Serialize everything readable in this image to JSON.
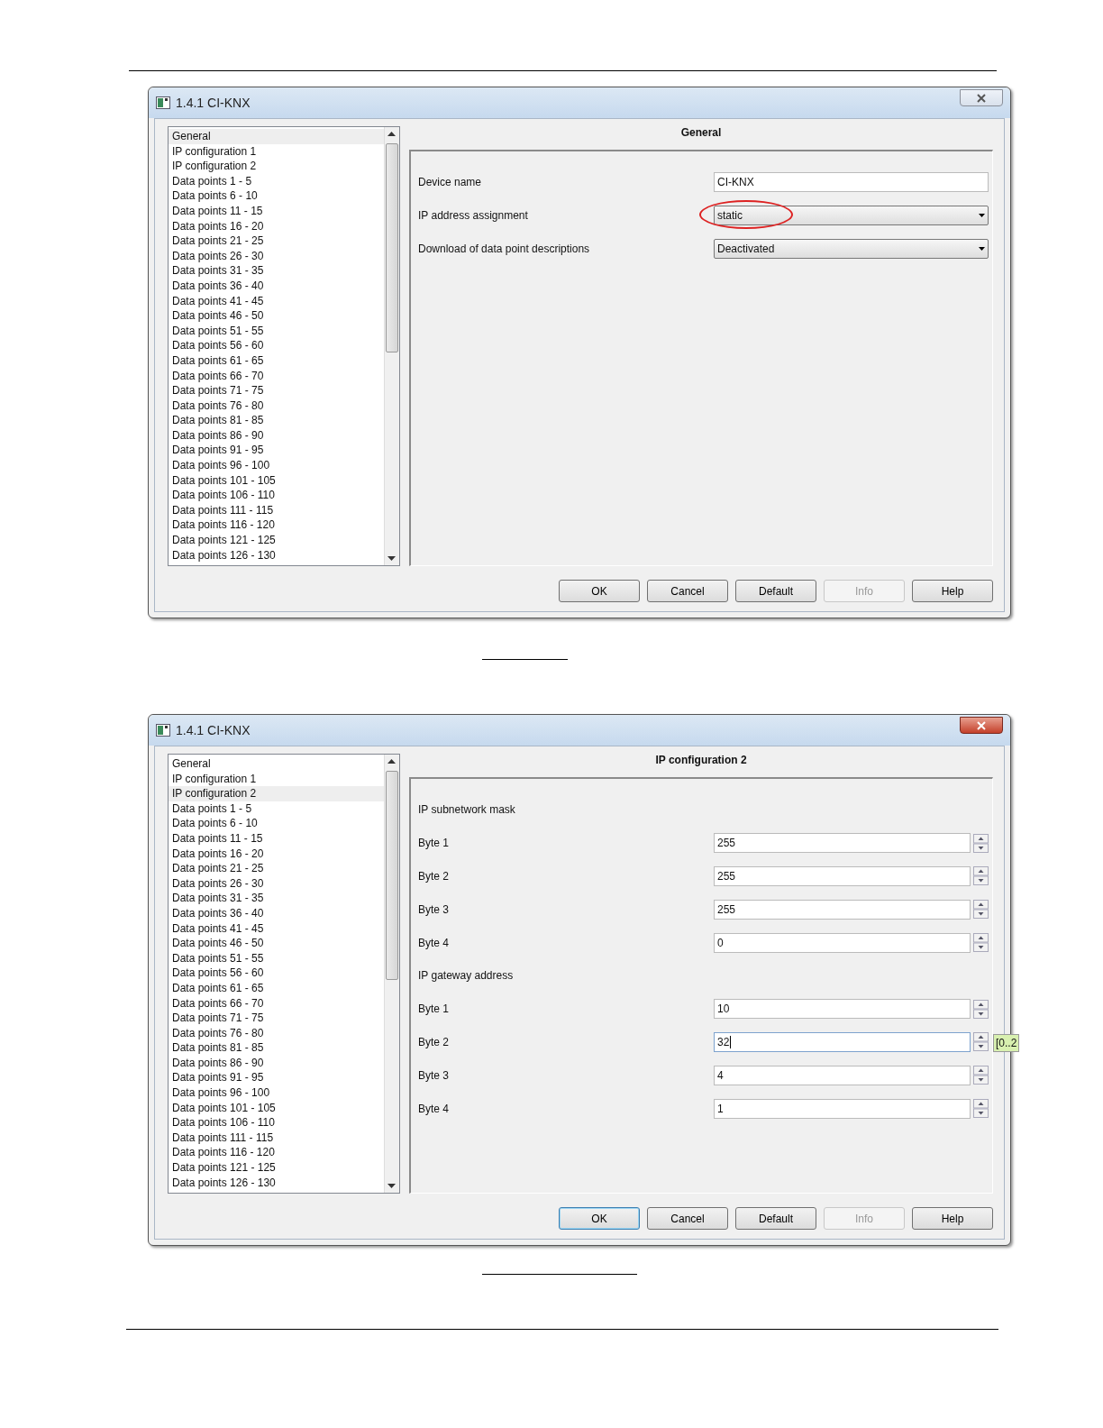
{
  "dialogs": [
    {
      "title": "1.4.1 CI-KNX",
      "active": false,
      "sidebar": {
        "items": [
          {
            "label": "General",
            "selected": true
          },
          {
            "label": "IP configuration 1",
            "selected": false
          },
          {
            "label": "IP configuration 2",
            "selected": false
          },
          {
            "label": "Data points 1 - 5",
            "selected": false
          },
          {
            "label": "Data points 6 - 10",
            "selected": false
          },
          {
            "label": "Data points 11 - 15",
            "selected": false
          },
          {
            "label": "Data points 16 - 20",
            "selected": false
          },
          {
            "label": "Data points 21 - 25",
            "selected": false
          },
          {
            "label": "Data points 26 - 30",
            "selected": false
          },
          {
            "label": "Data points 31 - 35",
            "selected": false
          },
          {
            "label": "Data points 36 - 40",
            "selected": false
          },
          {
            "label": "Data points 41 - 45",
            "selected": false
          },
          {
            "label": "Data points 46 - 50",
            "selected": false
          },
          {
            "label": "Data points 51 - 55",
            "selected": false
          },
          {
            "label": "Data points 56 - 60",
            "selected": false
          },
          {
            "label": "Data points 61 - 65",
            "selected": false
          },
          {
            "label": "Data points 66 - 70",
            "selected": false
          },
          {
            "label": "Data points 71 - 75",
            "selected": false
          },
          {
            "label": "Data points 76 - 80",
            "selected": false
          },
          {
            "label": "Data points 81 - 85",
            "selected": false
          },
          {
            "label": "Data points 86 - 90",
            "selected": false
          },
          {
            "label": "Data points 91 - 95",
            "selected": false
          },
          {
            "label": "Data points 96 - 100",
            "selected": false
          },
          {
            "label": "Data points 101 - 105",
            "selected": false
          },
          {
            "label": "Data points 106 - 110",
            "selected": false
          },
          {
            "label": "Data points 111 - 115",
            "selected": false
          },
          {
            "label": "Data points 116 - 120",
            "selected": false
          },
          {
            "label": "Data points 121 - 125",
            "selected": false
          },
          {
            "label": "Data points 126 - 130",
            "selected": false
          }
        ]
      },
      "panel": {
        "title": "General",
        "rows": [
          {
            "kind": "text",
            "label": "Device name",
            "value": "CI-KNX"
          },
          {
            "kind": "dropdown",
            "label": "IP address assignment",
            "value": "static",
            "circled": true
          },
          {
            "kind": "dropdown",
            "label": "Download of data point descriptions",
            "value": "Deactivated",
            "circled": false
          }
        ]
      },
      "buttons": [
        {
          "label": "OK",
          "disabled": false,
          "default": false
        },
        {
          "label": "Cancel",
          "disabled": false,
          "default": false
        },
        {
          "label": "Default",
          "disabled": false,
          "default": false
        },
        {
          "label": "Info",
          "disabled": true,
          "default": false
        },
        {
          "label": "Help",
          "disabled": false,
          "default": false
        }
      ]
    },
    {
      "title": "1.4.1 CI-KNX",
      "active": true,
      "sidebar": {
        "items": [
          {
            "label": "General",
            "selected": false
          },
          {
            "label": "IP configuration 1",
            "selected": false
          },
          {
            "label": "IP configuration 2",
            "selected": true
          },
          {
            "label": "Data points 1 - 5",
            "selected": false
          },
          {
            "label": "Data points 6 - 10",
            "selected": false
          },
          {
            "label": "Data points 11 - 15",
            "selected": false
          },
          {
            "label": "Data points 16 - 20",
            "selected": false
          },
          {
            "label": "Data points 21 - 25",
            "selected": false
          },
          {
            "label": "Data points 26 - 30",
            "selected": false
          },
          {
            "label": "Data points 31 - 35",
            "selected": false
          },
          {
            "label": "Data points 36 - 40",
            "selected": false
          },
          {
            "label": "Data points 41 - 45",
            "selected": false
          },
          {
            "label": "Data points 46 - 50",
            "selected": false
          },
          {
            "label": "Data points 51 - 55",
            "selected": false
          },
          {
            "label": "Data points 56 - 60",
            "selected": false
          },
          {
            "label": "Data points 61 - 65",
            "selected": false
          },
          {
            "label": "Data points 66 - 70",
            "selected": false
          },
          {
            "label": "Data points 71 - 75",
            "selected": false
          },
          {
            "label": "Data points 76 - 80",
            "selected": false
          },
          {
            "label": "Data points 81 - 85",
            "selected": false
          },
          {
            "label": "Data points 86 - 90",
            "selected": false
          },
          {
            "label": "Data points 91 - 95",
            "selected": false
          },
          {
            "label": "Data points 96 - 100",
            "selected": false
          },
          {
            "label": "Data points 101 - 105",
            "selected": false
          },
          {
            "label": "Data points 106 - 110",
            "selected": false
          },
          {
            "label": "Data points 111 - 115",
            "selected": false
          },
          {
            "label": "Data points 116 - 120",
            "selected": false
          },
          {
            "label": "Data points 121 - 125",
            "selected": false
          },
          {
            "label": "Data points 126 - 130",
            "selected": false
          }
        ]
      },
      "panel": {
        "title": "IP configuration 2",
        "rows": [
          {
            "kind": "heading",
            "label": "IP subnetwork mask"
          },
          {
            "kind": "spin",
            "label": "Byte 1",
            "value": "255",
            "focused": false
          },
          {
            "kind": "spin",
            "label": "Byte 2",
            "value": "255",
            "focused": false
          },
          {
            "kind": "spin",
            "label": "Byte 3",
            "value": "255",
            "focused": false
          },
          {
            "kind": "spin",
            "label": "Byte 4",
            "value": "0",
            "focused": false
          },
          {
            "kind": "heading",
            "label": "IP gateway address"
          },
          {
            "kind": "spin",
            "label": "Byte 1",
            "value": "10",
            "focused": false
          },
          {
            "kind": "spin",
            "label": "Byte 2",
            "value": "32",
            "focused": true,
            "tooltip": "[0..2"
          },
          {
            "kind": "spin",
            "label": "Byte 3",
            "value": "4",
            "focused": false
          },
          {
            "kind": "spin",
            "label": "Byte 4",
            "value": "1",
            "focused": false
          }
        ]
      },
      "buttons": [
        {
          "label": "OK",
          "disabled": false,
          "default": true
        },
        {
          "label": "Cancel",
          "disabled": false,
          "default": false
        },
        {
          "label": "Default",
          "disabled": false,
          "default": false
        },
        {
          "label": "Info",
          "disabled": true,
          "default": false
        },
        {
          "label": "Help",
          "disabled": false,
          "default": false
        }
      ]
    }
  ]
}
